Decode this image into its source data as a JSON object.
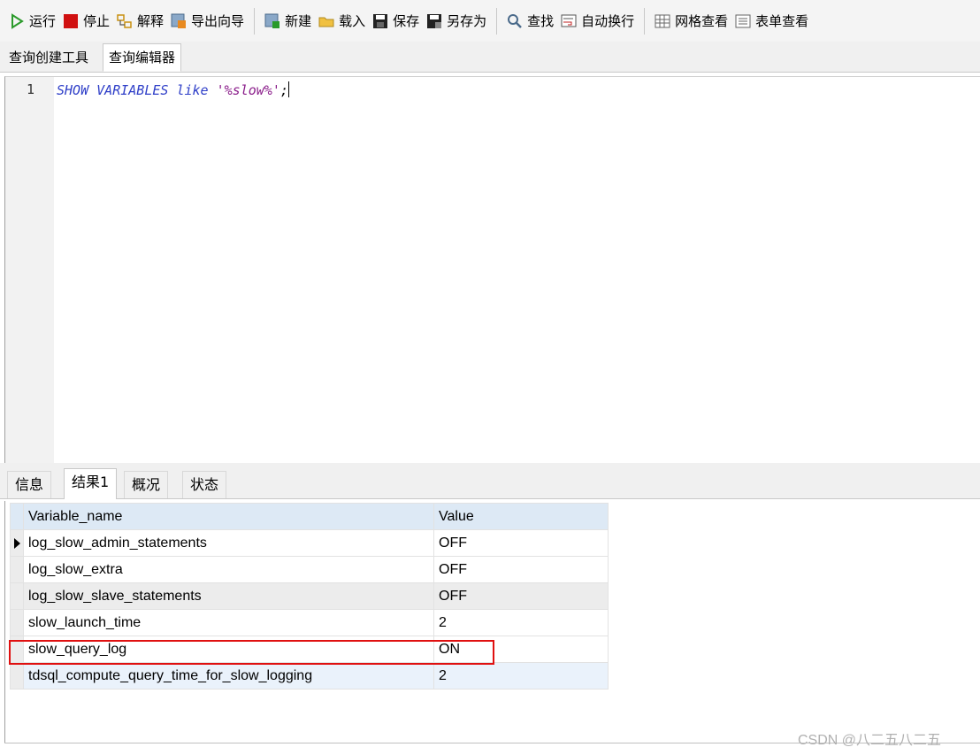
{
  "toolbar": {
    "run": "运行",
    "stop": "停止",
    "explain": "解释",
    "export_wizard": "导出向导",
    "new": "新建",
    "load": "载入",
    "save": "保存",
    "save_as": "另存为",
    "find": "查找",
    "word_wrap": "自动换行",
    "grid_view": "网格查看",
    "form_view": "表单查看"
  },
  "editor_tabs": [
    "查询创建工具",
    "查询编辑器"
  ],
  "editor": {
    "line_number": "1",
    "kw1": "SHOW VARIABLES like ",
    "str": "'%slow%'",
    "end": ";"
  },
  "result_tabs": [
    "信息",
    "结果1",
    "概况",
    "状态"
  ],
  "grid": {
    "columns": [
      "Variable_name",
      "Value"
    ],
    "rows": [
      [
        "log_slow_admin_statements",
        "OFF"
      ],
      [
        "log_slow_extra",
        "OFF"
      ],
      [
        "log_slow_slave_statements",
        "OFF"
      ],
      [
        "slow_launch_time",
        "2"
      ],
      [
        "slow_query_log",
        "ON"
      ],
      [
        "tdsql_compute_query_time_for_slow_logging",
        "2"
      ]
    ]
  },
  "watermark": "CSDN @八二五八二五",
  "colors": {
    "keyword": "#2f3fc8",
    "string": "#8a1c8a",
    "highlight": "#e01010",
    "header": "#dde9f5"
  }
}
